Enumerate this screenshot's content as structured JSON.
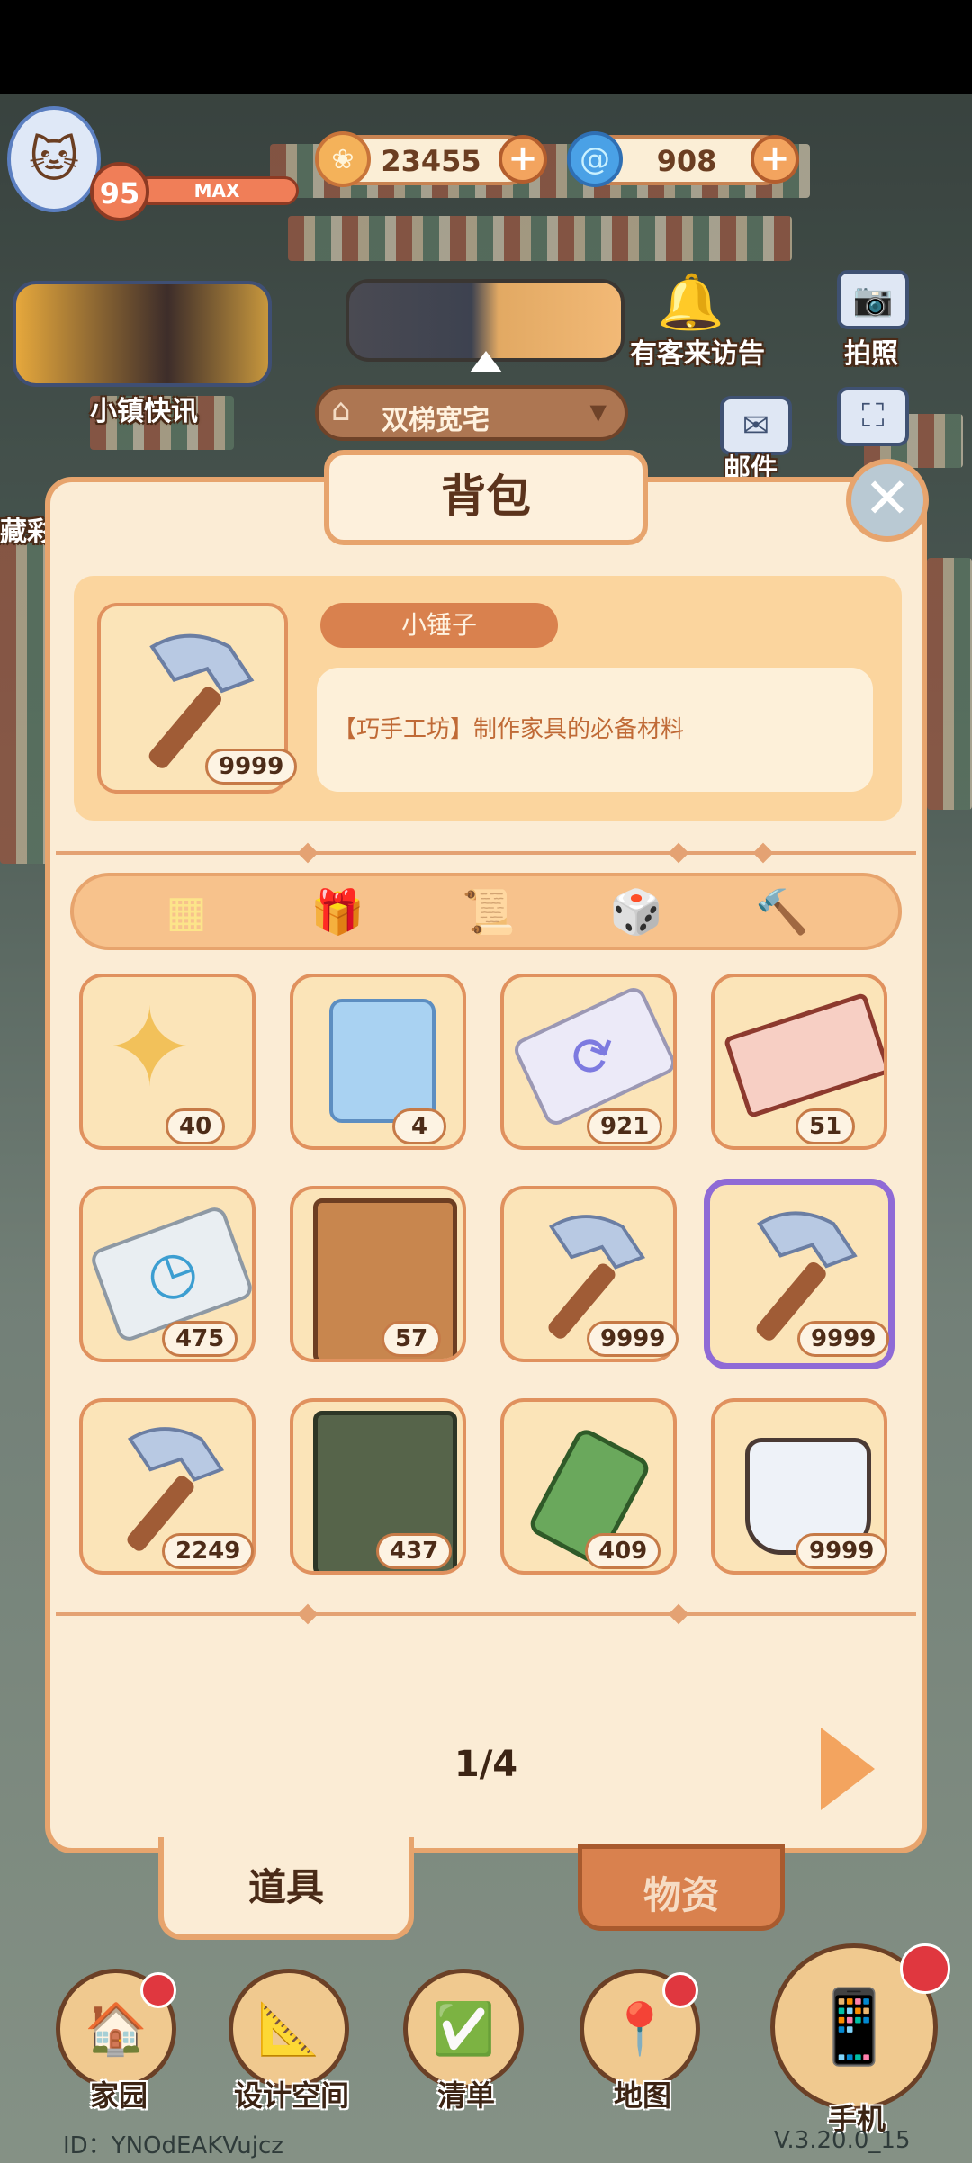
{
  "hud": {
    "level": "95",
    "level_max": "MAX",
    "coins": "23455",
    "gems": "908",
    "event_label": "小镇快讯",
    "room_name": "双梯宽宅",
    "notice_label": "有客来访告",
    "photo_label": "拍照",
    "mail_label": "邮件",
    "left_label": "藏彩"
  },
  "bag": {
    "title": "背包",
    "selected": {
      "name": "小锤子",
      "count": "9999",
      "description": "【巧手工坊】制作家具的必备材料"
    },
    "category_tabs": [
      {
        "icon": "grid-icon"
      },
      {
        "icon": "gift-icon"
      },
      {
        "icon": "scroll-icon"
      },
      {
        "icon": "dice-icon"
      },
      {
        "icon": "hammer-icon"
      }
    ],
    "items": [
      {
        "icon": "star-sparkle-icon",
        "count": "40"
      },
      {
        "icon": "blueprint-bag-icon",
        "count": "4"
      },
      {
        "icon": "refresh-card-icon",
        "count": "921"
      },
      {
        "icon": "ticket-icon",
        "count": "51"
      },
      {
        "icon": "clock-card-icon",
        "count": "475"
      },
      {
        "icon": "brown-book-icon",
        "count": "57"
      },
      {
        "icon": "hammer-icon",
        "count": "9999"
      },
      {
        "icon": "hammer-icon",
        "count": "9999"
      },
      {
        "icon": "hammer-icon",
        "count": "2249"
      },
      {
        "icon": "green-book-icon",
        "count": "437"
      },
      {
        "icon": "lotion-bottle-icon",
        "count": "409"
      },
      {
        "icon": "glue-pot-icon",
        "count": "9999"
      }
    ],
    "page": "1/4",
    "bottom_tabs": {
      "active": "道具",
      "inactive": "物资"
    }
  },
  "nav": [
    {
      "label": "家园",
      "icon": "home-icon"
    },
    {
      "label": "设计空间",
      "icon": "design-icon"
    },
    {
      "label": "清单",
      "icon": "checklist-icon"
    },
    {
      "label": "地图",
      "icon": "map-pin-icon"
    },
    {
      "label": "手机",
      "icon": "phone-icon"
    }
  ],
  "footer": {
    "player_id": "ID：YNOdEAKVujcz",
    "version": "V.3.20.0_15"
  },
  "colors": {
    "panel_bg": "#fbecd5",
    "panel_border": "#e7a46d",
    "accent": "#d9814e",
    "selection": "#8f6ad6",
    "badge_red": "#e0373f"
  }
}
